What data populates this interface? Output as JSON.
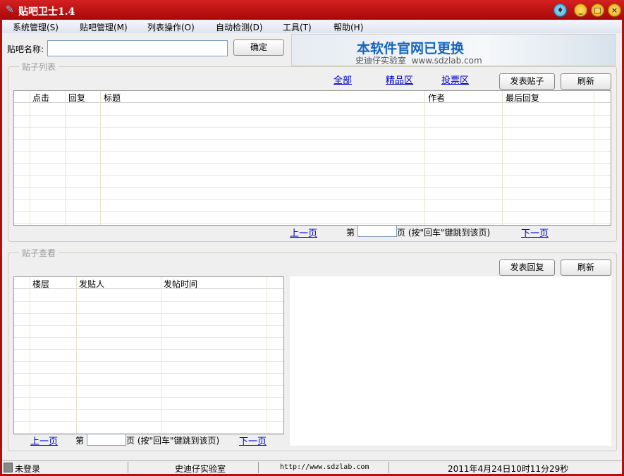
{
  "window": {
    "title": "贴吧卫士1.4"
  },
  "menu": [
    "系统管理(S)",
    "贴吧管理(M)",
    "列表操作(O)",
    "自动检测(D)",
    "工具(T)",
    "帮助(H)"
  ],
  "top": {
    "name_label": "贴吧名称:",
    "name_value": "",
    "confirm": "确定"
  },
  "banner": {
    "headline": "本软件官网已更换",
    "sub": "史迪仔实验室  www.sdzlab.com"
  },
  "posts": {
    "legend": "贴子列表",
    "filters": [
      "全部",
      "精品区",
      "投票区"
    ],
    "new_post": "发表贴子",
    "refresh": "刷新",
    "columns": [
      "点击",
      "回复",
      "标题",
      "作者",
      "最后回复"
    ],
    "pager": {
      "prev": "上一页",
      "page_prefix": "第",
      "page_value": "",
      "page_suffix": "页 (按\"回车\"键跳到该页)",
      "next": "下一页"
    }
  },
  "view": {
    "legend": "贴子查看",
    "reply": "发表回复",
    "refresh": "刷新",
    "columns": [
      "楼层",
      "发贴人",
      "发帖时间"
    ],
    "pager": {
      "prev": "上一页",
      "page_prefix": "第",
      "page_value": "",
      "page_suffix": "页 (按\"回车\"键跳到该页)",
      "next": "下一页"
    }
  },
  "status": {
    "login": "未登录",
    "lab": "史迪仔实验室",
    "url": "http://www.sdzlab.com",
    "datetime": "2011年4月24日10时11分29秒"
  }
}
